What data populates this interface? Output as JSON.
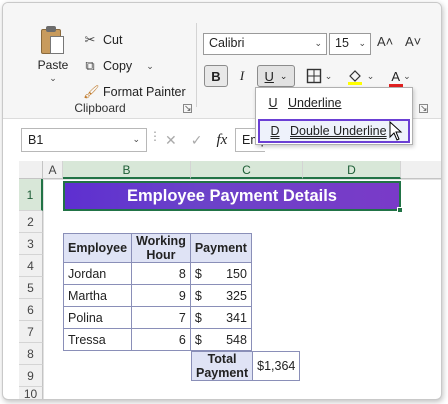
{
  "clipboard": {
    "paste_label": "Paste",
    "cut_label": "Cut",
    "copy_label": "Copy",
    "format_painter_label": "Format Painter",
    "group_label": "Clipboard"
  },
  "font": {
    "name": "Calibri",
    "size": "15",
    "bold_label": "B",
    "italic_label": "I",
    "underline_label": "U",
    "font_color_label": "A",
    "grow_label": "A˄",
    "shrink_label": "A˅"
  },
  "underline_menu": {
    "items": [
      {
        "icon": "U",
        "label": "Underline"
      },
      {
        "icon": "D",
        "label": "Double Underline"
      }
    ]
  },
  "formula_bar": {
    "name_box": "B1",
    "fx_label": "fx",
    "content": "Employee Payment Details"
  },
  "sheet": {
    "columns": [
      "A",
      "B",
      "C",
      "D"
    ],
    "rows": [
      "1",
      "2",
      "3",
      "4",
      "5",
      "6",
      "7",
      "8",
      "9",
      "10"
    ],
    "title": "Employee Payment Details",
    "headers": [
      "Employee",
      "Working Hour",
      "Payment"
    ],
    "data": [
      {
        "employee": "Jordan",
        "hours": "8",
        "currency": "$",
        "payment": "150"
      },
      {
        "employee": "Martha",
        "hours": "9",
        "currency": "$",
        "payment": "325"
      },
      {
        "employee": "Polina",
        "hours": "7",
        "currency": "$",
        "payment": "341"
      },
      {
        "employee": "Tressa",
        "hours": "6",
        "currency": "$",
        "payment": "548"
      }
    ],
    "total_label": "Total Payment",
    "total_currency": "$",
    "total_value": "1,364"
  },
  "colors": {
    "title_fill": "#6b42c9",
    "selection_green": "#217346",
    "highlight_border": "#6b3fd4",
    "table_header_fill": "#dfe3f5",
    "fill_color_bar": "#ffff00",
    "font_color_bar": "#e02020"
  }
}
